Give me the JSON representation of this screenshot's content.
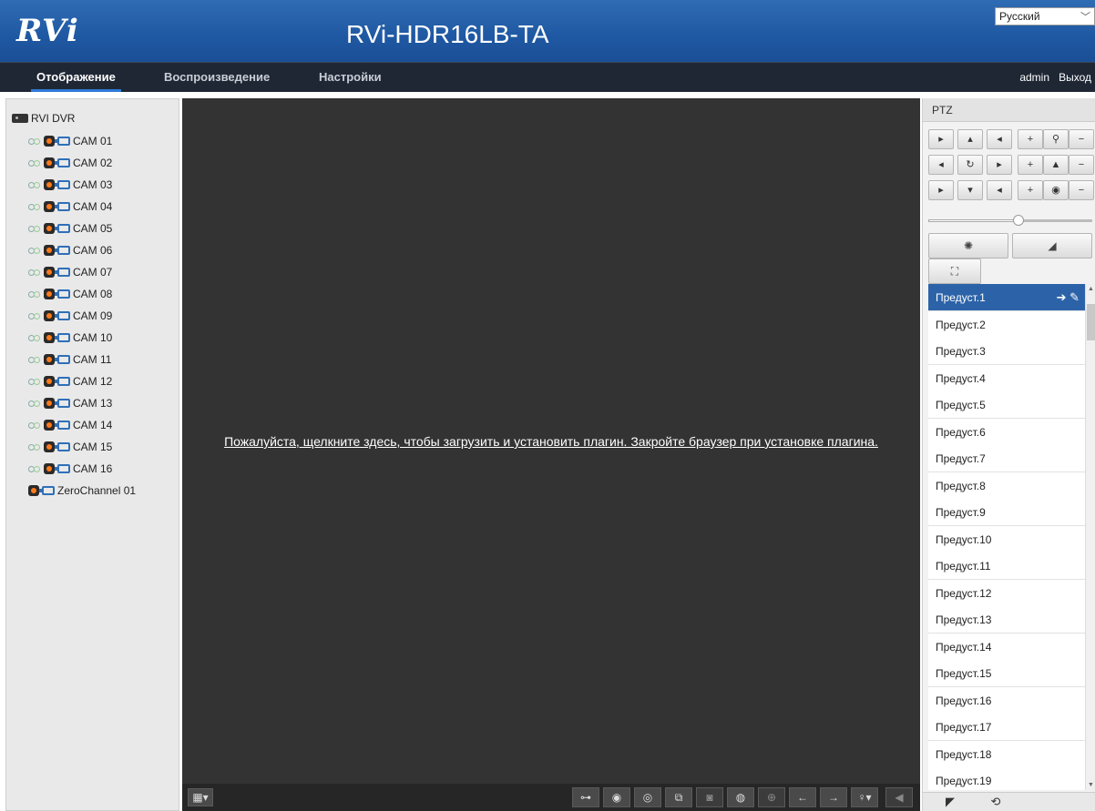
{
  "header": {
    "logo_text": "RVi",
    "model": "RVi-HDR16LB-TA",
    "language": "Русский"
  },
  "nav": {
    "tabs": [
      "Отображение",
      "Воспроизведение",
      "Настройки"
    ],
    "user": "admin",
    "logout": "Выход"
  },
  "tree": {
    "root": "RVI DVR",
    "cameras": [
      "CAM 01",
      "CAM 02",
      "CAM 03",
      "CAM 04",
      "CAM 05",
      "CAM 06",
      "CAM 07",
      "CAM 08",
      "CAM 09",
      "CAM 10",
      "CAM 11",
      "CAM 12",
      "CAM 13",
      "CAM 14",
      "CAM 15",
      "CAM 16"
    ],
    "zero_channel": "ZeroChannel 01"
  },
  "video": {
    "plugin_message": "Пожалуйста, щелкните здесь, чтобы загрузить и установить плагин. Закройте браузер при установке плагина.",
    "toolbar_icons": [
      "stop-all-icon",
      "record-all-icon",
      "capture-all-icon",
      "fullscreen-icon",
      "snapshot-icon",
      "record-icon",
      "zoom-icon",
      "prev-page-icon",
      "next-page-icon",
      "microphone-icon",
      "volume-icon"
    ]
  },
  "ptz": {
    "title": "PTZ",
    "presets": [
      "Предуст.1",
      "Предуст.2",
      "Предуст.3",
      "Предуст.4",
      "Предуст.5",
      "Предуст.6",
      "Предуст.7",
      "Предуст.8",
      "Предуст.9",
      "Предуст.10",
      "Предуст.11",
      "Предуст.12",
      "Предуст.13",
      "Предуст.14",
      "Предуст.15",
      "Предуст.16",
      "Предуст.17",
      "Предуст.18",
      "Предуст.19"
    ],
    "selected_preset": "Предуст.1",
    "speed_level": 0.55
  }
}
